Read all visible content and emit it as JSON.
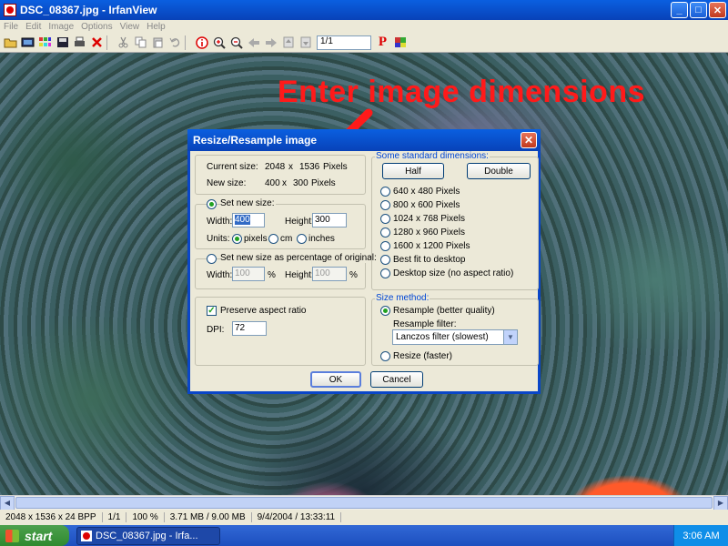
{
  "window": {
    "title": "DSC_08367.jpg - IrfanView",
    "min": "_",
    "max": "□",
    "close": "✕"
  },
  "menu": [
    "File",
    "Edit",
    "Image",
    "Options",
    "View",
    "Help"
  ],
  "toolbar": {
    "page_value": "1/1"
  },
  "annotation": {
    "text": "Enter image dimensions",
    "color": "#ff1a1a"
  },
  "dialog": {
    "title": "Resize/Resample image",
    "close": "✕",
    "current_size_label": "Current size:",
    "current_size_w": "2048",
    "current_size_x": "x",
    "current_size_h": "1536",
    "current_size_unit": "Pixels",
    "new_size_label": "New size:",
    "new_size_w": "400",
    "new_size_x": "x",
    "new_size_h": "300",
    "new_size_unit": "Pixels",
    "set_new_size": "Set new size:",
    "width_label": "Width:",
    "width_value": "400",
    "height_label": "Height:",
    "height_value": "300",
    "units_label": "Units:",
    "unit_pixels": "pixels",
    "unit_cm": "cm",
    "unit_inches": "inches",
    "set_percent": "Set new size as percentage of original:",
    "pct_width_label": "Width:",
    "pct_width_value": "100",
    "pct_height_label": "Height:",
    "pct_height_value": "100",
    "pct_sign": "%",
    "preserve": "Preserve aspect ratio",
    "dpi_label": "DPI:",
    "dpi_value": "72",
    "std_legend": "Some standard dimensions:",
    "half": "Half",
    "double": "Double",
    "std_options": [
      "640 x 480 Pixels",
      "800 x 600 Pixels",
      "1024 x 768 Pixels",
      "1280 x 960 Pixels",
      "1600 x 1200 Pixels",
      "Best fit to desktop",
      "Desktop size (no aspect ratio)"
    ],
    "method_legend": "Size method:",
    "resample": "Resample (better quality)",
    "resample_filter_label": "Resample filter:",
    "resample_filter_value": "Lanczos filter (slowest)",
    "resize": "Resize (faster)",
    "ok": "OK",
    "cancel": "Cancel"
  },
  "status": [
    "2048 x 1536 x 24 BPP",
    "1/1",
    "100 %",
    "3.71 MB / 9.00 MB",
    "9/4/2004 / 13:33:11"
  ],
  "taskbar": {
    "start": "start",
    "task": "DSC_08367.jpg - Irfa...",
    "clock": "3:06 AM"
  }
}
